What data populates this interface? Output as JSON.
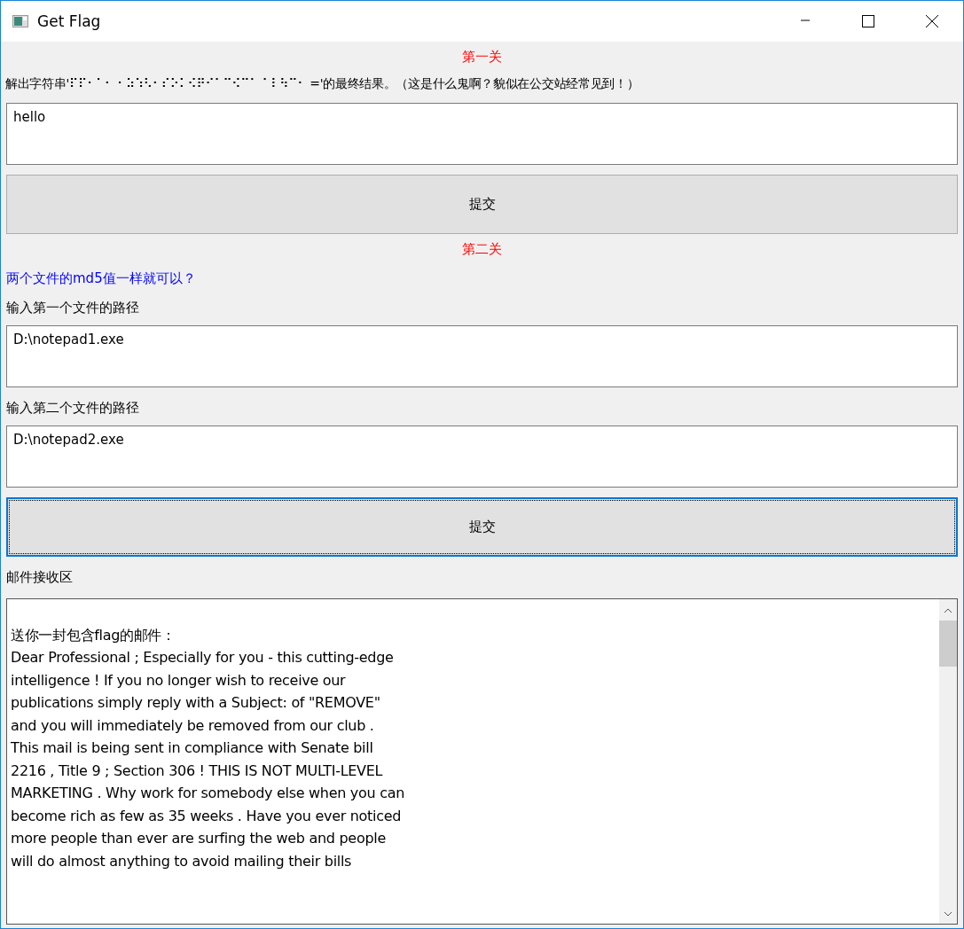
{
  "window": {
    "title": "Get Flag"
  },
  "level1": {
    "heading": "第一关",
    "prompt": "解出字符串'⠏⠏⠂⠁⠂ ⠂⠵⠱⠣⠂⠎⠕⠅⠪⠟⠊⠁⠉⠪⠉⠁ ⠁⠇⠳⠉⠂ ='的最终结果。（这是什么鬼啊？貌似在公交站经常见到！）",
    "answer": "hello",
    "submit": "提交"
  },
  "level2": {
    "heading": "第二关",
    "hint": "两个文件的md5值一样就可以？",
    "label1": "输入第一个文件的路径",
    "path1": "D:\\notepad1.exe",
    "label2": "输入第二个文件的路径",
    "path2": "D:\\notepad2.exe",
    "submit": "提交",
    "submit_focused": true
  },
  "mail": {
    "label": "邮件接收区",
    "body": "\n送你一封包含flag的邮件：\nDear Professional ; Especially for you - this cutting-edge\nintelligence ! If you no longer wish to receive our\npublications simply reply with a Subject: of \"REMOVE\"\nand you will immediately be removed from our club .\nThis mail is being sent in compliance with Senate bill\n2216 , Title 9 ; Section 306 ! THIS IS NOT MULTI-LEVEL\nMARKETING . Why work for somebody else when you can\nbecome rich as few as 35 weeks . Have you ever noticed\nmore people than ever are surfing the web and people\nwill do almost anything to avoid mailing their bills"
  }
}
